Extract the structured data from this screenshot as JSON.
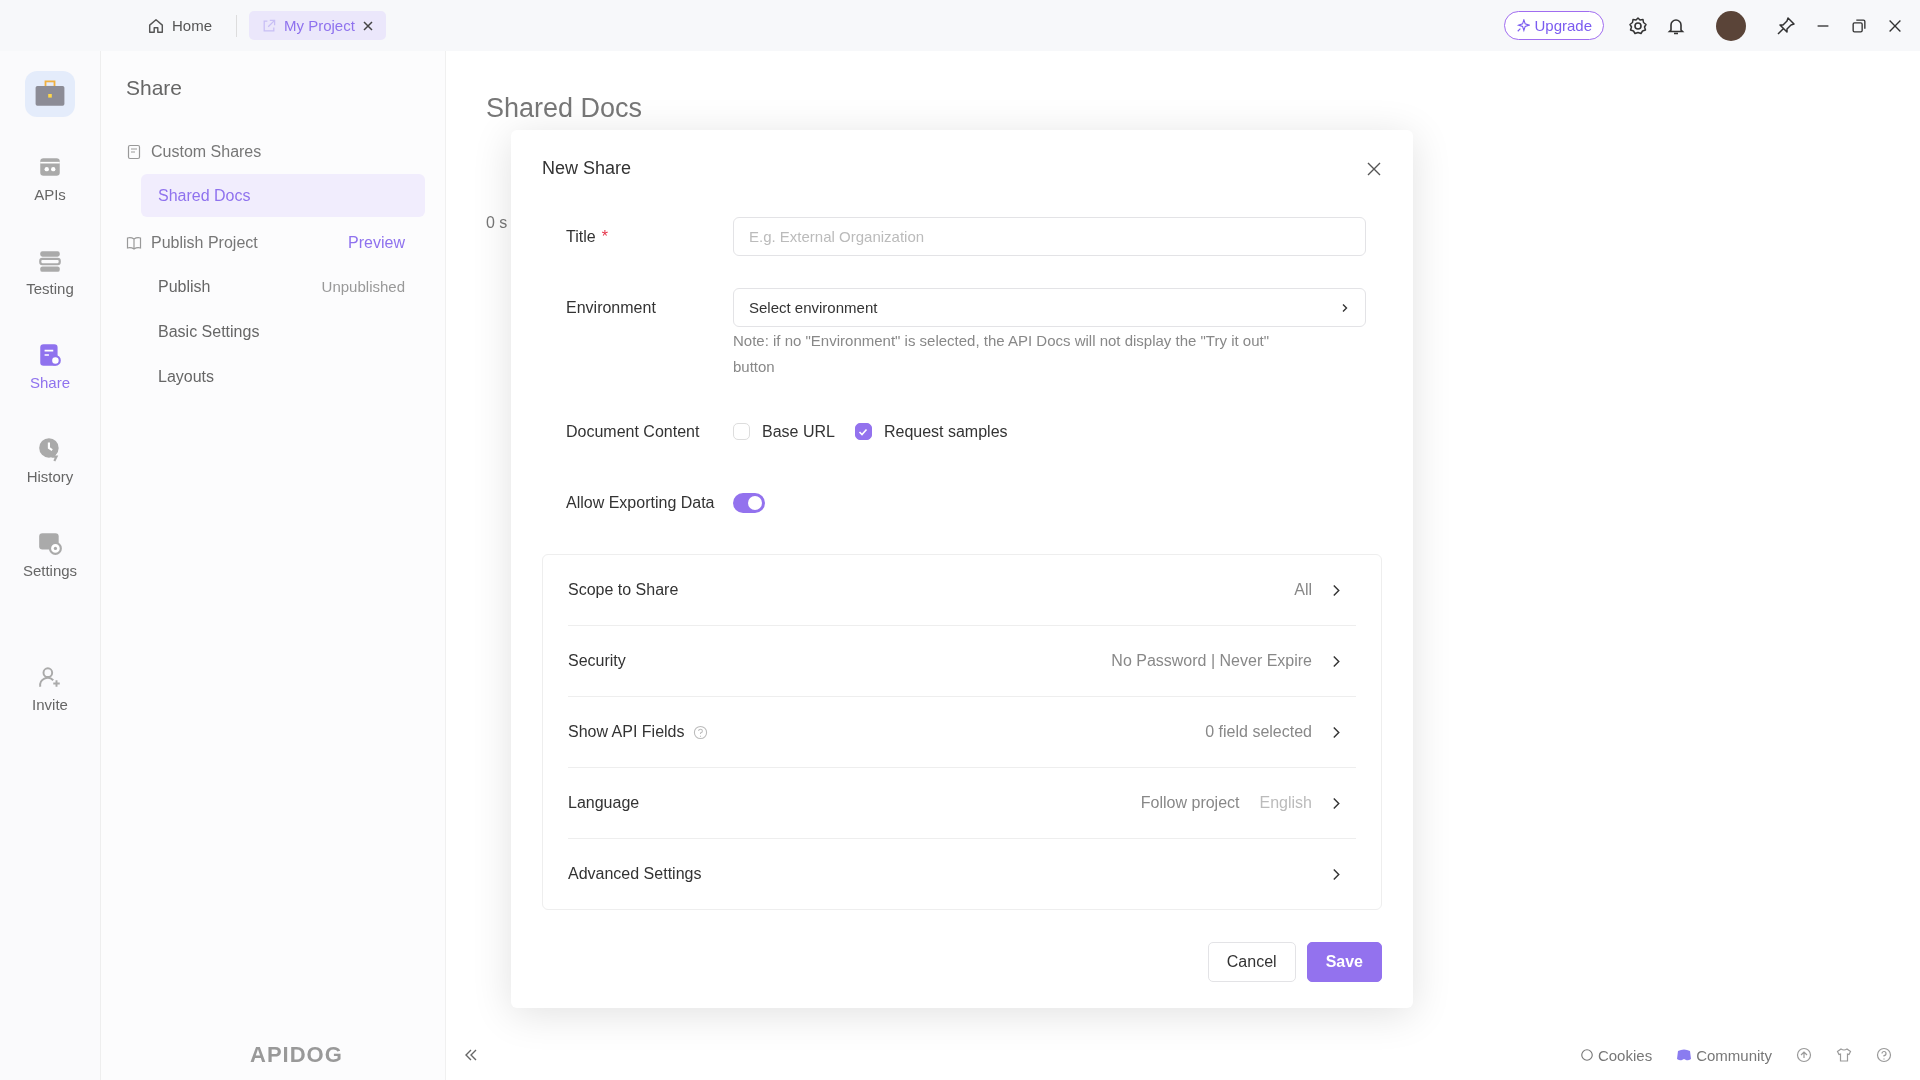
{
  "title_bar": {
    "tabs": [
      {
        "label": "Home",
        "selected": false,
        "closable": false
      },
      {
        "label": "My Project",
        "selected": true,
        "closable": true
      }
    ],
    "upgrade_button": "Upgrade"
  },
  "rail": {
    "items": [
      {
        "label": "APIs",
        "kind": "apis",
        "selected": false
      },
      {
        "label": "Testing",
        "kind": "testing",
        "selected": false
      },
      {
        "label": "Share",
        "kind": "share",
        "selected": true
      },
      {
        "label": "History",
        "kind": "history",
        "selected": false
      },
      {
        "label": "Settings",
        "kind": "settings",
        "selected": false
      },
      {
        "label": "Invite",
        "kind": "invite",
        "selected": false
      }
    ]
  },
  "share_sidebar": {
    "title": "Share",
    "sections": [
      {
        "label": "Custom Shares",
        "kind": "custom",
        "children": [
          {
            "label": "Shared Docs",
            "selected": true
          }
        ]
      },
      {
        "label": "Publish Project",
        "kind": "publish",
        "link": "Preview",
        "children": [
          {
            "label": "Publish",
            "status": "Unpublished",
            "selected": false
          },
          {
            "label": "Basic Settings",
            "selected": false
          },
          {
            "label": "Layouts",
            "selected": false
          }
        ]
      }
    ]
  },
  "main": {
    "title": "Shared Docs",
    "count": "0 s"
  },
  "dialog": {
    "title": "New Share",
    "required_mark": "*",
    "fields": [
      {
        "kind": "text",
        "label": "Title",
        "required": true,
        "placeholder": "E.g. External Organization"
      },
      {
        "kind": "select",
        "label": "Environment",
        "value": "Select environment",
        "note": "Note: if no \"Environment\" is selected, the API Docs will not display the \"Try it out\" button"
      },
      {
        "kind": "checkboxes",
        "label": "Document Content",
        "options": [
          {
            "label": "Base URL",
            "checked": false
          },
          {
            "label": "Request samples",
            "checked": true
          }
        ]
      },
      {
        "kind": "switch",
        "label": "Allow Exporting Data",
        "on": true
      }
    ],
    "settings": [
      {
        "label": "Scope to Share",
        "value": "All"
      },
      {
        "label": "Security",
        "value": "No Password | Never Expire"
      },
      {
        "label": "Show API Fields",
        "help": true,
        "value": "0 field selected"
      },
      {
        "label": "Language",
        "value": "Follow project",
        "secondary": "English"
      },
      {
        "label": "Advanced Settings"
      }
    ],
    "buttons": [
      {
        "label": "Cancel",
        "kind": "secondary"
      },
      {
        "label": "Save",
        "kind": "primary"
      }
    ]
  },
  "footer": {
    "logo": "APIDOG",
    "links": [
      {
        "label": "Cookies",
        "kind": "cookies"
      },
      {
        "label": "Community",
        "kind": "community"
      }
    ]
  }
}
